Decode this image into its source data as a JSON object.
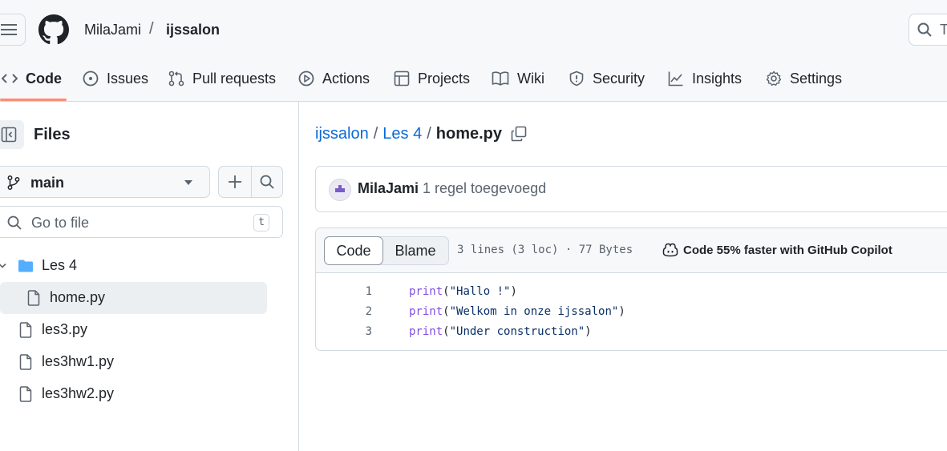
{
  "header": {
    "owner": "MilaJami",
    "separator": "/",
    "repo": "ijssalon",
    "search_placeholder": "T"
  },
  "tabs": [
    {
      "label": "Code",
      "icon": "code-icon",
      "selected": true
    },
    {
      "label": "Issues",
      "icon": "issue-icon"
    },
    {
      "label": "Pull requests",
      "icon": "pull-request-icon"
    },
    {
      "label": "Actions",
      "icon": "play-icon"
    },
    {
      "label": "Projects",
      "icon": "table-icon"
    },
    {
      "label": "Wiki",
      "icon": "book-icon"
    },
    {
      "label": "Security",
      "icon": "shield-icon"
    },
    {
      "label": "Insights",
      "icon": "graph-icon"
    },
    {
      "label": "Settings",
      "icon": "gear-icon"
    }
  ],
  "sidebar": {
    "title": "Files",
    "branch": "main",
    "goto_placeholder": "Go to file",
    "goto_shortcut": "t",
    "tree": [
      {
        "label": "Les 4",
        "type": "folder",
        "expanded": true
      },
      {
        "label": "home.py",
        "type": "file",
        "selected": true
      },
      {
        "label": "les3.py",
        "type": "file"
      },
      {
        "label": "les3hw1.py",
        "type": "file"
      },
      {
        "label": "les3hw2.py",
        "type": "file"
      }
    ]
  },
  "main": {
    "breadcrumb": {
      "repo": "ijssalon",
      "folder": "Les 4",
      "file": "home.py",
      "sep": "/"
    },
    "commit": {
      "author": "MilaJami",
      "message": "1 regel toegevoegd"
    },
    "file": {
      "code_tab": "Code",
      "blame_tab": "Blame",
      "meta": "3 lines (3 loc) · 77 Bytes",
      "copilot": "Code 55% faster with GitHub Copilot",
      "lines": [
        {
          "num": "1",
          "fn": "print",
          "open": "(",
          "str": "\"Hallo !\"",
          "close": ")"
        },
        {
          "num": "2",
          "fn": "print",
          "open": "(",
          "str": "\"Welkom in onze ijssalon\"",
          "close": ")"
        },
        {
          "num": "3",
          "fn": "print",
          "open": "(",
          "str": "\"Under construction\"",
          "close": ")"
        }
      ]
    }
  },
  "colors": {
    "accent_link": "#0969da",
    "tab_underline": "#fd8c73",
    "code_function": "#8250df",
    "code_string": "#0a3069"
  }
}
